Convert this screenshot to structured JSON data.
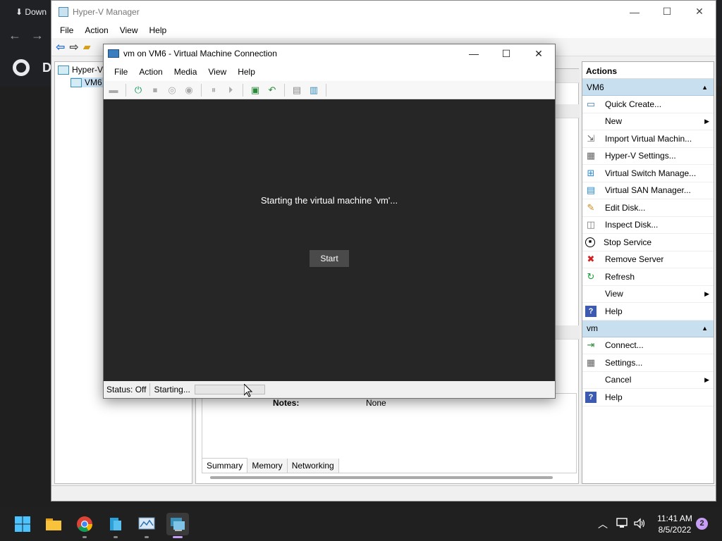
{
  "chrome": {
    "tab_label": "Down",
    "page_letter": "D"
  },
  "hyperv": {
    "title": "Hyper-V Manager",
    "menu": [
      "File",
      "Action",
      "View",
      "Help"
    ],
    "tree": {
      "root": "Hyper-V",
      "server": "VM6"
    },
    "details": {
      "notes_label": "Notes:",
      "notes_value": "None"
    },
    "tabs": [
      "Summary",
      "Memory",
      "Networking"
    ]
  },
  "actions": {
    "header": "Actions",
    "server_section": {
      "title": "VM6",
      "items": [
        {
          "label": "Quick Create...",
          "icon": "quick-create-icon"
        },
        {
          "label": "New",
          "icon": "none",
          "submenu": true
        },
        {
          "label": "Import Virtual Machin...",
          "icon": "import-icon"
        },
        {
          "label": "Hyper-V Settings...",
          "icon": "settings-icon"
        },
        {
          "label": "Virtual Switch Manage...",
          "icon": "switch-icon"
        },
        {
          "label": "Virtual SAN Manager...",
          "icon": "san-icon"
        },
        {
          "label": "Edit Disk...",
          "icon": "edit-disk-icon"
        },
        {
          "label": "Inspect Disk...",
          "icon": "inspect-disk-icon"
        },
        {
          "label": "Stop Service",
          "icon": "stop-icon"
        },
        {
          "label": "Remove Server",
          "icon": "remove-icon"
        },
        {
          "label": "Refresh",
          "icon": "refresh-icon"
        },
        {
          "label": "View",
          "icon": "none",
          "submenu": true
        },
        {
          "label": "Help",
          "icon": "help-icon"
        }
      ]
    },
    "vm_section": {
      "title": "vm",
      "items": [
        {
          "label": "Connect...",
          "icon": "connect-icon"
        },
        {
          "label": "Settings...",
          "icon": "settings-icon"
        },
        {
          "label": "Cancel",
          "icon": "none",
          "submenu": true
        },
        {
          "label": "Help",
          "icon": "help-icon"
        }
      ]
    }
  },
  "vmc": {
    "title": "vm on VM6 - Virtual Machine Connection",
    "menu": [
      "File",
      "Action",
      "Media",
      "View",
      "Help"
    ],
    "message": "Starting the virtual machine 'vm'...",
    "start_button": "Start",
    "status_label": "Status: Off",
    "progress_label": "Starting...",
    "progress": 0.0
  },
  "taskbar": {
    "time": "11:41 AM",
    "date": "8/5/2022",
    "notifications": "2"
  },
  "colors": {
    "accent": "#c69ef6",
    "section_bg": "#c8dff0",
    "vm_screen": "#262626"
  }
}
